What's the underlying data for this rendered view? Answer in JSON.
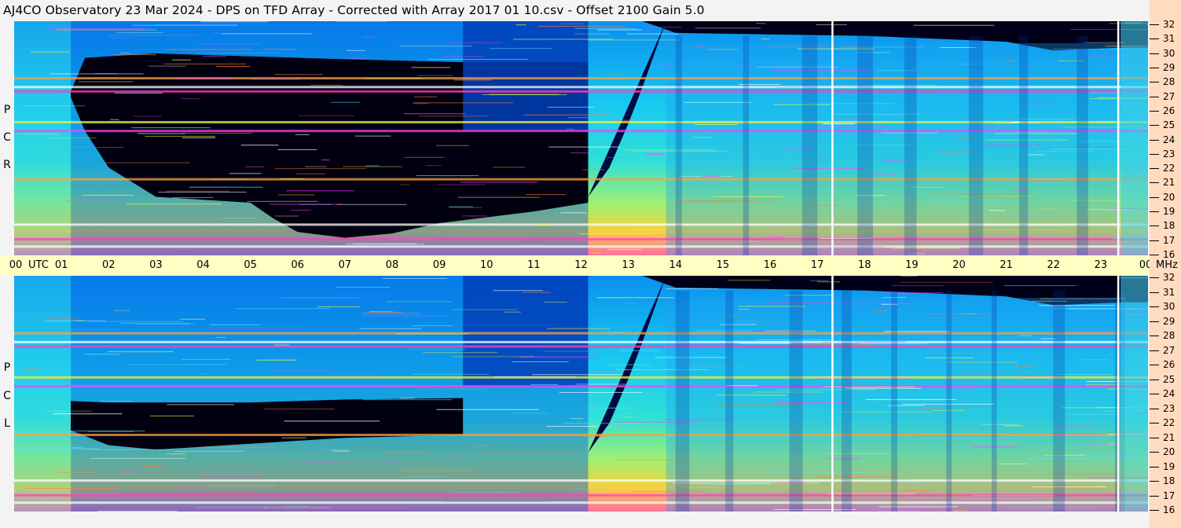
{
  "title": "AJ4CO Observatory  23 Mar 2024  -  DPS on TFD Array  -  Corrected with Array 2017 01 10.csv  -  Offset 2100  Gain 5.0",
  "chart_data": {
    "type": "heatmap",
    "x_unit_label": "UTC",
    "y_unit_label": "MHz",
    "hour_labels": [
      "00",
      "01",
      "02",
      "03",
      "04",
      "05",
      "06",
      "07",
      "08",
      "09",
      "10",
      "11",
      "12",
      "13",
      "14",
      "15",
      "16",
      "17",
      "18",
      "19",
      "20",
      "21",
      "22",
      "23",
      "00"
    ],
    "xlim": [
      0,
      24
    ],
    "mhz_labels": [
      "32",
      "31",
      "30",
      "29",
      "28",
      "27",
      "26",
      "25",
      "24",
      "23",
      "22",
      "21",
      "20",
      "19",
      "18",
      "17",
      "16"
    ],
    "ylim": [
      16,
      32
    ],
    "colorscale": [
      "#000020",
      "#0010a0",
      "#0050e0",
      "#00a8f8",
      "#20e0e0",
      "#80f080",
      "#f0f040",
      "#ffb040",
      "#ff4080",
      "#ff40ff",
      "#ffffff"
    ],
    "panels": [
      {
        "polarization_letters": [
          "R",
          "C",
          "P"
        ],
        "dark_region": {
          "start_hour": 1.2,
          "end_hour": 12.15,
          "profile": [
            [
              1.2,
              26.8
            ],
            [
              1.5,
              24.5
            ],
            [
              2.0,
              22.0
            ],
            [
              3.0,
              20.0
            ],
            [
              4.0,
              19.8
            ],
            [
              5.0,
              19.6
            ],
            [
              5.5,
              18.5
            ],
            [
              6.0,
              17.6
            ],
            [
              7.0,
              17.2
            ],
            [
              8.0,
              17.5
            ],
            [
              9.0,
              18.2
            ],
            [
              10.0,
              18.6
            ],
            [
              11.0,
              19.0
            ],
            [
              12.15,
              19.6
            ]
          ],
          "upper_profile": [
            [
              1.2,
              27.2
            ],
            [
              1.5,
              29.5
            ],
            [
              3.0,
              29.8
            ],
            [
              5.0,
              29.6
            ],
            [
              7.0,
              29.4
            ],
            [
              9.5,
              29.2
            ]
          ],
          "after_09_30_upper": 32
        },
        "late_dark_upper": [
          [
            12.15,
            32
          ],
          [
            13.3,
            32
          ],
          [
            14.0,
            31.2
          ],
          [
            18.0,
            31.0
          ],
          [
            21.0,
            30.6
          ],
          [
            22.0,
            30.0
          ],
          [
            23.5,
            30.2
          ]
        ],
        "dawn_edge": [
          [
            12.15,
            20.0
          ],
          [
            12.6,
            22.0
          ],
          [
            13.0,
            25.0
          ],
          [
            13.3,
            27.5
          ],
          [
            13.8,
            32
          ]
        ],
        "rfi_bands_mhz": [
          27.2,
          27.5,
          28.1,
          25.1,
          24.5,
          18.1,
          17.1,
          16.6,
          21.2
        ],
        "white_lines_hour": [
          17.3,
          23.35
        ]
      },
      {
        "polarization_letters": [
          "L",
          "C",
          "P"
        ],
        "dark_region": {
          "start_hour": 1.2,
          "end_hour": 9.5,
          "profile": [
            [
              1.2,
              21.5
            ],
            [
              2.0,
              20.5
            ],
            [
              3.0,
              20.2
            ],
            [
              5.0,
              20.6
            ],
            [
              7.0,
              21.0
            ],
            [
              9.5,
              21.2
            ]
          ],
          "upper_profile": [
            [
              1.2,
              23.5
            ],
            [
              2.0,
              23.4
            ],
            [
              5.0,
              23.4
            ],
            [
              7.0,
              23.6
            ],
            [
              9.5,
              23.7
            ]
          ],
          "after_09_30_upper": 32
        },
        "late_dark_upper": [
          [
            12.15,
            32
          ],
          [
            13.3,
            32
          ],
          [
            14.0,
            31.2
          ],
          [
            18.0,
            31.0
          ],
          [
            21.0,
            30.6
          ],
          [
            22.0,
            30.0
          ],
          [
            23.5,
            30.2
          ]
        ],
        "dawn_edge": [
          [
            12.15,
            20.0
          ],
          [
            12.6,
            22.0
          ],
          [
            13.0,
            25.0
          ],
          [
            13.3,
            27.5
          ],
          [
            13.8,
            32
          ]
        ],
        "rfi_bands_mhz": [
          27.2,
          27.5,
          28.1,
          25.1,
          24.5,
          18.1,
          17.1,
          16.6,
          21.2
        ],
        "white_lines_hour": [
          17.3,
          23.35
        ]
      }
    ]
  }
}
